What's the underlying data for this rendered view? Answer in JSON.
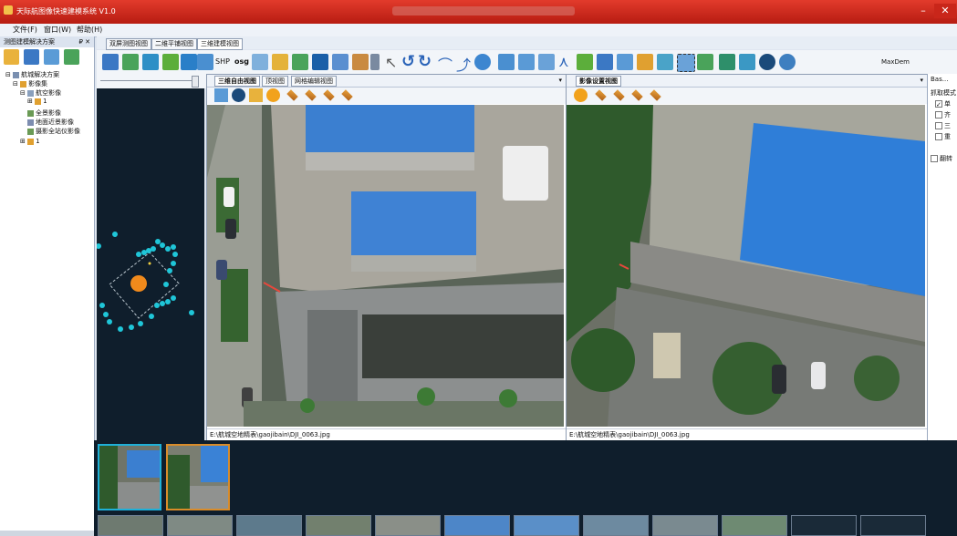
{
  "window": {
    "title": "天际航图像快速建模系统 V1.0",
    "controls": [
      "–",
      "✕"
    ]
  },
  "menu": [
    "文件(F)",
    "窗口(W)",
    "帮助(H)"
  ],
  "left_panel": {
    "title": "测图建模解决方案",
    "pin": "₽ ✕",
    "tree": [
      {
        "label": "航城解决方案",
        "level": 0,
        "expander": "⊟"
      },
      {
        "label": "影像集",
        "level": 1,
        "expander": "⊟"
      },
      {
        "label": "航空影像",
        "level": 2,
        "expander": "⊟"
      },
      {
        "label": "1",
        "level": 3,
        "expander": "⊞"
      },
      {
        "label": "全景影像",
        "level": 2,
        "expander": ""
      },
      {
        "label": "地面近景影像",
        "level": 2,
        "expander": ""
      },
      {
        "label": "摄影全站仪影像",
        "level": 2,
        "expander": ""
      },
      {
        "label": "1",
        "level": 1,
        "expander": "⊞"
      }
    ]
  },
  "doc_tabs": [
    {
      "label": "双屏测图视图",
      "active": false
    },
    {
      "label": "二维平铺视图",
      "active": false
    },
    {
      "label": "三维建模视图",
      "active": true
    }
  ],
  "toolbar": {
    "shp_label": "SHP",
    "osg_label": "osg",
    "maxdem_label": "MaxDem"
  },
  "left_view": {
    "tabs": [
      {
        "label": "三维自由视图",
        "active": true
      },
      {
        "label": "顶视图",
        "active": false
      },
      {
        "label": "网格编辑视图",
        "active": false
      }
    ],
    "dropdown": "▾",
    "path": "E:\\航城空地精表\\gaojibain\\DJI_0063.jpg"
  },
  "right_view": {
    "tabs": [
      {
        "label": "影像设置视图",
        "active": true
      }
    ],
    "dropdown": "▾",
    "path": "E:\\航城空地精表\\gaojibain\\DJI_0063.jpg"
  },
  "right_panel": {
    "title": "Bas...",
    "heading": "抓取模式",
    "options": [
      {
        "label": "单",
        "checked": true
      },
      {
        "label": "齐",
        "checked": false
      },
      {
        "label": "三",
        "checked": false
      },
      {
        "label": "重",
        "checked": false
      }
    ],
    "extra": "翻转"
  },
  "colors": {
    "title_red": "#c62a1f",
    "nav_bg": "#0f1e2c",
    "point_cyan": "#1fc6d8",
    "camera_orange": "#f08a1c",
    "selected_border": "#d98c2a"
  }
}
